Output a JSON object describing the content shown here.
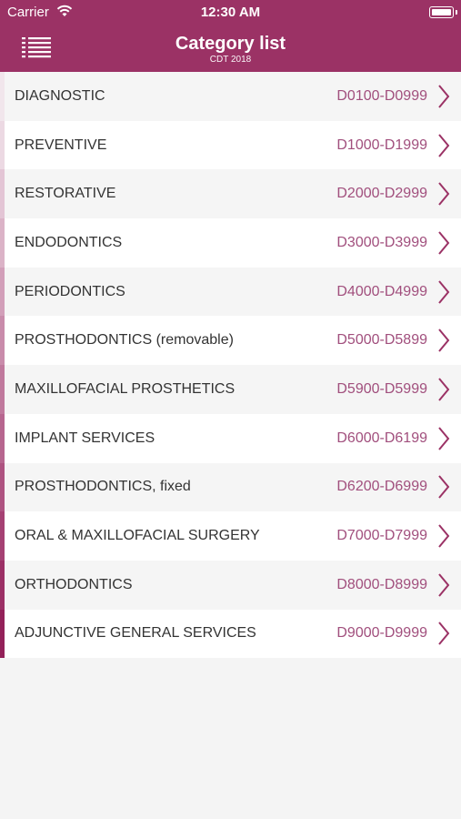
{
  "status_bar": {
    "carrier": "Carrier",
    "time": "12:30 AM"
  },
  "header": {
    "title": "Category list",
    "subtitle": "CDT 2018",
    "menu_icon": "list-menu-icon"
  },
  "colors": {
    "brand": "#9b3265",
    "code_text": "#a14f7d",
    "chevron": "#9b3265"
  },
  "categories": [
    {
      "name": "DIAGNOSTIC",
      "codes": "D0100-D0999",
      "accent": "#f1e6ec"
    },
    {
      "name": "PREVENTIVE",
      "codes": "D1000-D1999",
      "accent": "#ecd9e3"
    },
    {
      "name": "RESTORATIVE",
      "codes": "D2000-D2999",
      "accent": "#e3c5d5"
    },
    {
      "name": "ENDODONTICS",
      "codes": "D3000-D3999",
      "accent": "#dbb3c7"
    },
    {
      "name": "PERIODONTICS",
      "codes": "D4000-D4999",
      "accent": "#d29fb9"
    },
    {
      "name": "PROSTHODONTICS (removable)",
      "codes": "D5000-D5899",
      "accent": "#c98cab"
    },
    {
      "name": "MAXILLOFACIAL PROSTHETICS",
      "codes": "D5900-D5999",
      "accent": "#c0799d"
    },
    {
      "name": "IMPLANT SERVICES",
      "codes": "D6000-D6199",
      "accent": "#b7668f"
    },
    {
      "name": "PROSTHODONTICS, fixed",
      "codes": "D6200-D6999",
      "accent": "#ae5381"
    },
    {
      "name": "ORAL & MAXILLOFACIAL SURGERY",
      "codes": "D7000-D7999",
      "accent": "#a54173"
    },
    {
      "name": "ORTHODONTICS",
      "codes": "D8000-D8999",
      "accent": "#9c3066"
    },
    {
      "name": "ADJUNCTIVE GENERAL SERVICES",
      "codes": "D9000-D9999",
      "accent": "#932159"
    }
  ]
}
